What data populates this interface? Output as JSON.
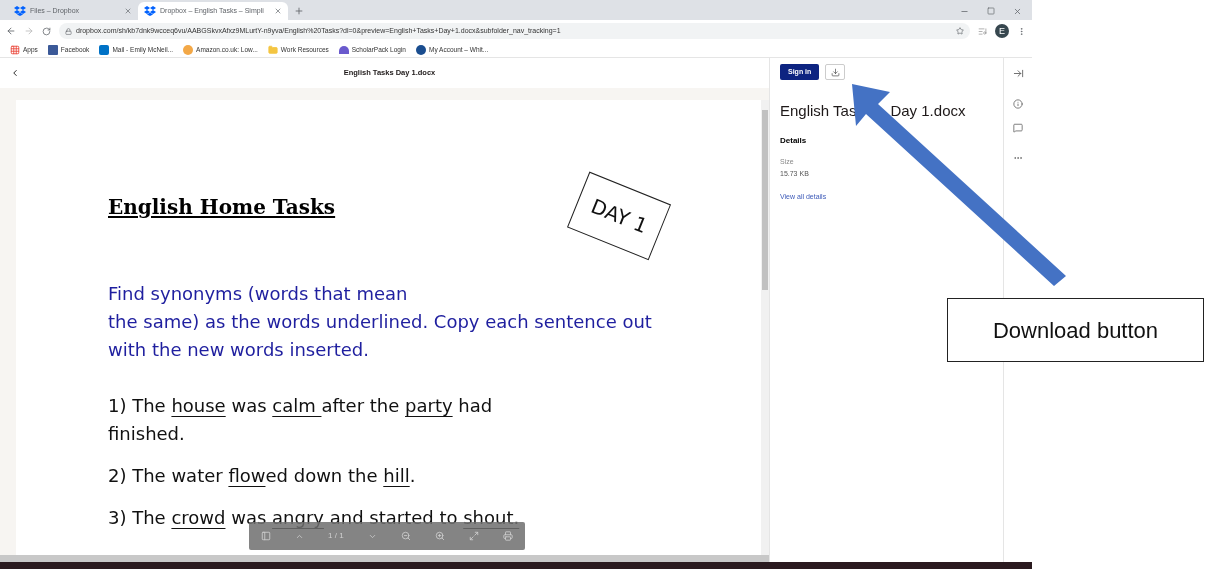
{
  "browser": {
    "tabs": [
      {
        "label": "Files – Dropbox",
        "selected": false
      },
      {
        "label": "Dropbox – English Tasks – Simpli",
        "selected": true
      }
    ],
    "url": "dropbox.com/sh/kb7dnk9wcceq6vu/AABGSkvxAfxz9MLurtY-n9yva/English%20Tasks?dl=0&preview=English+Tasks+Day+1.docx&subfolder_nav_tracking=1",
    "avatar": "E",
    "bookmarks": [
      "Apps",
      "Facebook",
      "Mail - Emily McNeil...",
      "Amazon.co.uk: Low...",
      "Work Resources",
      "ScholarPack Login",
      "My Account – Whit..."
    ]
  },
  "viewer": {
    "title": "English Tasks Day 1.docx",
    "document": {
      "heading": "English Home Tasks",
      "stamp": "DAY 1",
      "instruction_lines": [
        "Find synonyms (words that mean",
        "the same) as the words underlined. Copy each sentence out",
        "with the new words inserted."
      ],
      "sentences": [
        [
          {
            "text": "1) The "
          },
          {
            "text": "house",
            "underlined": true
          },
          {
            "text": " was "
          },
          {
            "text": "calm ",
            "underlined": true
          },
          {
            "text": " after the "
          },
          {
            "text": "party",
            "underlined": true
          },
          {
            "text": " had finished."
          }
        ],
        [
          {
            "text": "2) The water "
          },
          {
            "text": "flow",
            "underlined": true
          },
          {
            "text": "ed down the "
          },
          {
            "text": "hill",
            "underlined": true
          },
          {
            "text": "."
          }
        ],
        [
          {
            "text": "3) The "
          },
          {
            "text": "crowd",
            "underlined": true
          },
          {
            "text": " was "
          },
          {
            "text": "angry",
            "underlined": true
          },
          {
            "text": " and started to "
          },
          {
            "text": "shout.",
            "underlined": true
          }
        ]
      ]
    },
    "toolbar": {
      "page": "1 / 1"
    }
  },
  "sidebar": {
    "sign_in": "Sign in",
    "file_name_parts": [
      "English Tas",
      "Day 1.docx"
    ],
    "details_heading": "Details",
    "size_label": "Size",
    "size_value": "15.73 KB",
    "link": "View all details"
  },
  "annotation": {
    "label": "Download button"
  }
}
